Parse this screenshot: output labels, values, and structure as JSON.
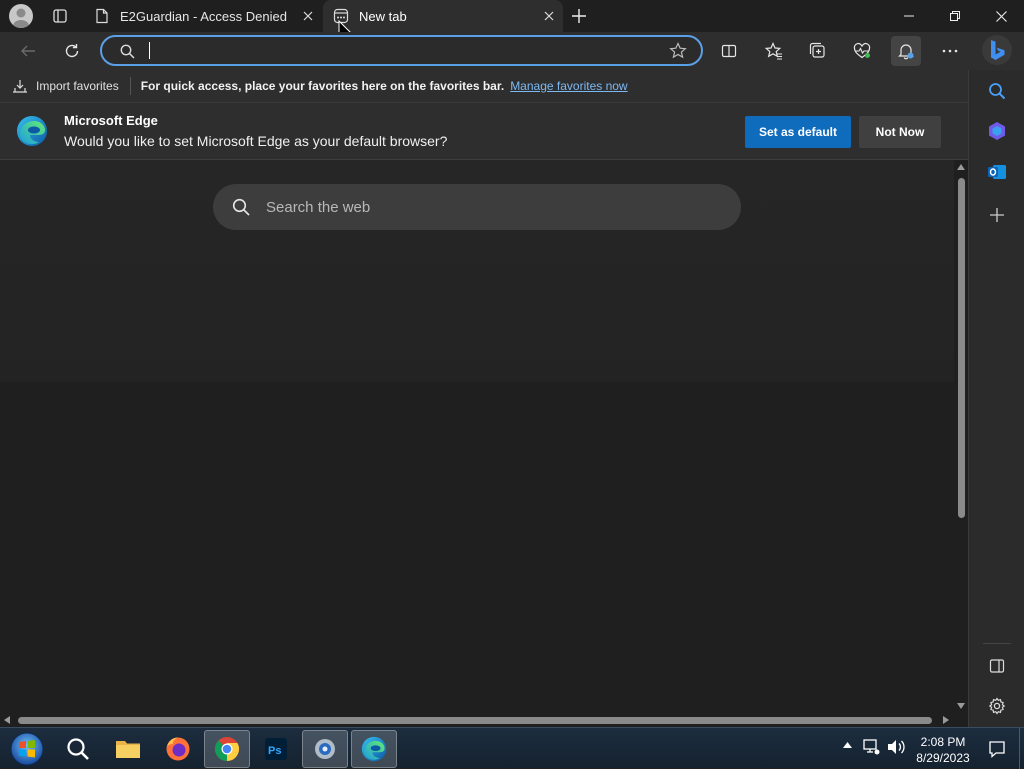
{
  "tabs": [
    {
      "title": "E2Guardian - Access Denied",
      "active": false
    },
    {
      "title": "New tab",
      "active": true
    }
  ],
  "address": {
    "value": "",
    "placeholder": ""
  },
  "favorites_bar": {
    "import_label": "Import favorites",
    "message": "For quick access, place your favorites here on the favorites bar.",
    "manage_link": "Manage favorites now"
  },
  "infobar": {
    "title": "Microsoft Edge",
    "text": "Would you like to set Microsoft Edge as your default browser?",
    "primary_button": "Set as default",
    "secondary_button": "Not Now"
  },
  "newtab": {
    "search_placeholder": "Search the web"
  },
  "taskbar": {
    "apps": [
      "start-orb",
      "search",
      "file-explorer",
      "firefox",
      "chrome",
      "photoshop",
      "app",
      "edge"
    ],
    "time": "2:08 PM",
    "date": "8/29/2023"
  },
  "colors": {
    "accent": "#0f6cbd",
    "link": "#7cb9f2",
    "focus_ring": "#5aa0e6"
  }
}
